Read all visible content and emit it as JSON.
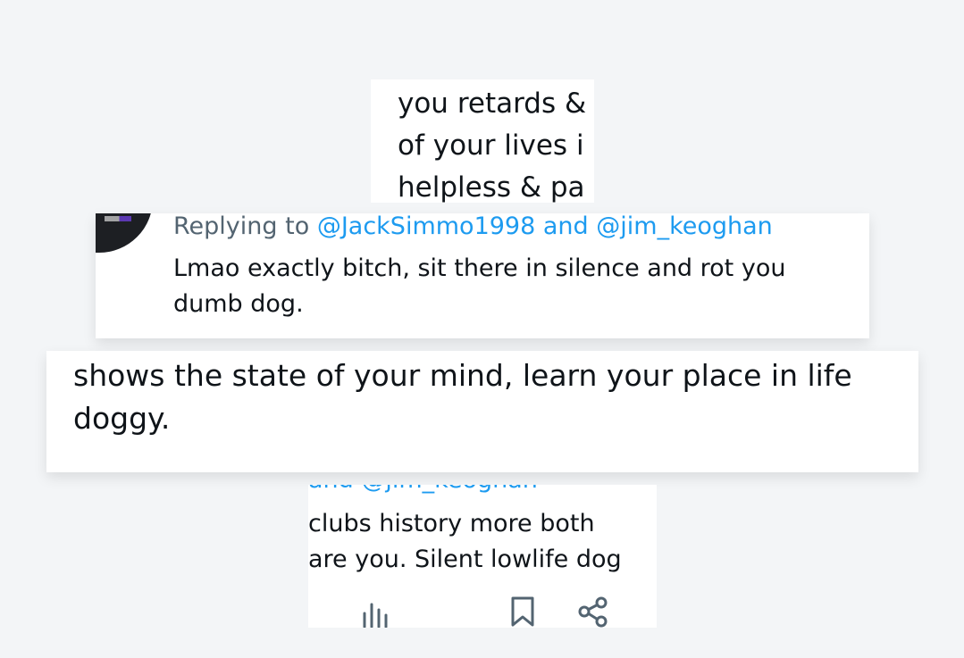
{
  "crop1": {
    "lines": [
      "you retards &",
      "of your lives i",
      "helpless & pa"
    ]
  },
  "crop2": {
    "reply_prefix": "Replying to",
    "mention1": "@JackSimmo1998",
    "connector": "and",
    "mention2": "@jim_keoghan",
    "text": "Lmao exactly bitch, sit there in silence and rot you dumb dog."
  },
  "crop3": {
    "text": "shows the state of your mind, learn your place in life doggy."
  },
  "crop4": {
    "cut_mention": "and @jim_keoghan",
    "lines": [
      "clubs history more both",
      "are you. Silent lowlife dog"
    ],
    "icons": [
      "views-icon",
      "bookmark-icon",
      "share-icon"
    ]
  },
  "colors": {
    "background": "#f3f5f7",
    "text": "#0f1419",
    "secondary": "#536471",
    "mention": "#1d9bf0"
  }
}
